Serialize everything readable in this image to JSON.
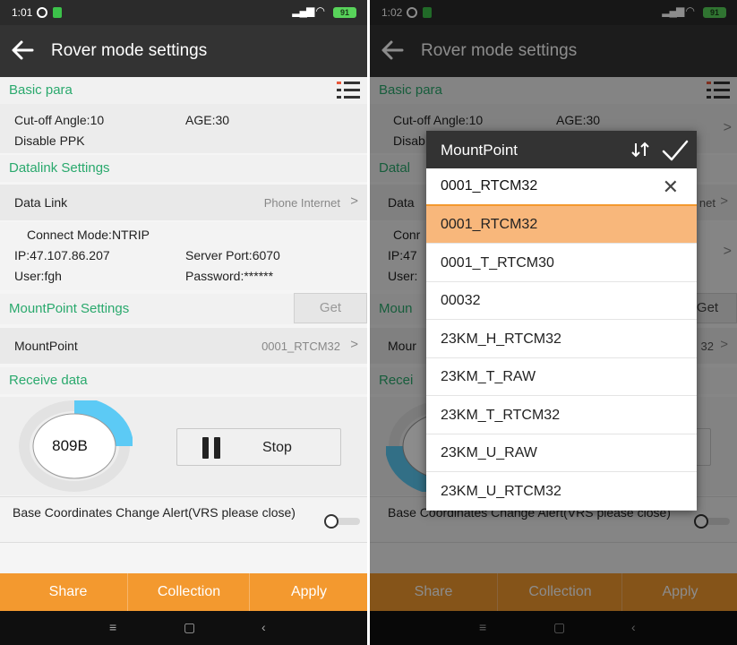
{
  "left_phone": {
    "status": {
      "time": "1:01",
      "battery": "91"
    },
    "title": "Rover mode settings",
    "basic_para": {
      "heading": "Basic para",
      "cutoff": "Cut-off Angle:10",
      "age": "AGE:30",
      "ppk": "Disable PPK"
    },
    "datalink": {
      "heading": "Datalink Settings",
      "row_label": "Data Link",
      "row_value": "Phone Internet",
      "connect_mode": "Connect Mode:NTRIP",
      "ip": "IP:47.107.86.207",
      "server_port": "Server Port:6070",
      "user": "User:fgh",
      "password": "Password:******"
    },
    "mountpoint": {
      "heading": "MountPoint Settings",
      "get_label": "Get",
      "row_label": "MountPoint",
      "row_value": "0001_RTCM32"
    },
    "receive": {
      "heading": "Receive data",
      "gauge_value": "809B",
      "gauge_fraction": 0.25,
      "stop_label": "Stop"
    },
    "alert_text": "Base Coordinates Change Alert(VRS please close)",
    "bottom": {
      "share": "Share",
      "collection": "Collection",
      "apply": "Apply"
    },
    "nav": {
      "menu": "≡",
      "home": "▢",
      "back": "‹"
    }
  },
  "right_phone": {
    "status": {
      "time": "1:02",
      "battery": "91"
    },
    "title": "Rover mode settings",
    "basic_para": {
      "heading": "Basic para",
      "cutoff": "Cut-off Angle:10",
      "age": "AGE:30",
      "ppk_partial": "Disab"
    },
    "datalink_partial": "Datal",
    "data_partial": "Data",
    "net_partial": "net",
    "conn_partial": "Conr",
    "ip_partial": "IP:47",
    "user_partial": "User:",
    "mount_partial": "Moun",
    "get_partial": "Get",
    "mour_partial": "Mour",
    "mount_val_partial": "32",
    "recei_partial": "Recei",
    "alert_text": "Base Coordinates Change Alert(VRS please close)",
    "bottom": {
      "share": "Share",
      "collection": "Collection",
      "apply": "Apply"
    },
    "nav": {
      "menu": "≡",
      "home": "▢",
      "back": "‹"
    },
    "dialog": {
      "title": "MountPoint",
      "search_value": "0001_RTCM32",
      "selected": "0001_RTCM32",
      "items": [
        "0001_RTCM32",
        "0001_T_RTCM30",
        "00032",
        "23KM_H_RTCM32",
        "23KM_T_RAW",
        "23KM_T_RTCM32",
        "23KM_U_RAW",
        "23KM_U_RTCM32"
      ]
    }
  },
  "colors": {
    "accent": "#f3992f",
    "section_green": "#2aa96d",
    "gauge_fill": "#5ccaf5",
    "title_bg": "#333333"
  }
}
